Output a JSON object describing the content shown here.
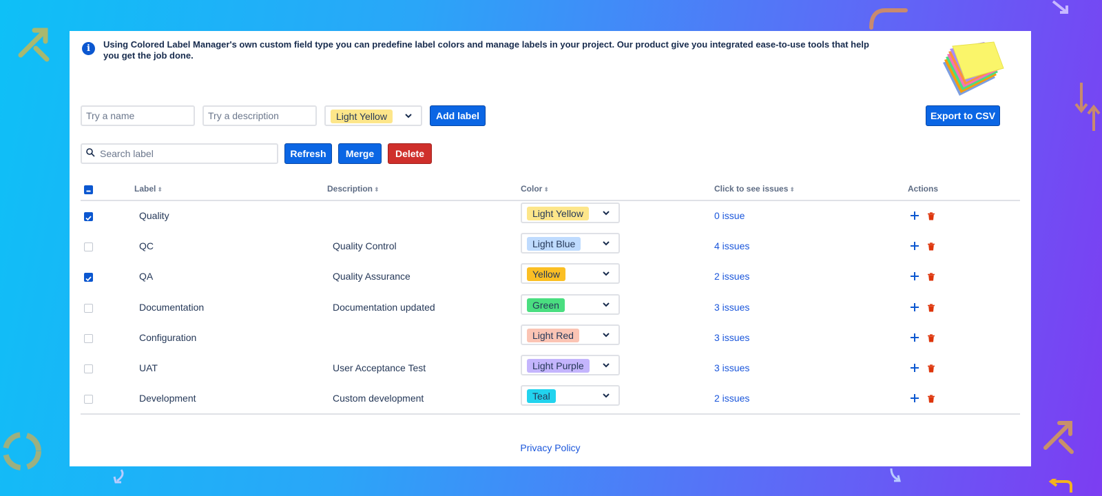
{
  "info": {
    "text": "Using Colored Label Manager's own custom field type you can predefine label colors and manage labels in your project. Our product give you integrated ease-to-use tools that help you get the job done."
  },
  "form": {
    "name_placeholder": "Try a name",
    "description_placeholder": "Try a description",
    "color_value": "Light Yellow",
    "add_label": "Add label",
    "export_csv": "Export to CSV"
  },
  "toolbar": {
    "search_placeholder": "Search label",
    "refresh": "Refresh",
    "merge": "Merge",
    "delete": "Delete"
  },
  "table": {
    "headers": {
      "label": "Label",
      "description": "Description",
      "color": "Color",
      "issues": "Click to see issues",
      "actions": "Actions"
    },
    "rows": [
      {
        "checked": true,
        "label": "Quality",
        "description": "",
        "color": "Light Yellow",
        "color_hex": "#fde68a",
        "issues": "0 issue"
      },
      {
        "checked": false,
        "label": "QC",
        "description": "Quality Control",
        "color": "Light Blue",
        "color_hex": "#bfdbfe",
        "issues": "4 issues"
      },
      {
        "checked": true,
        "label": "QA",
        "description": "Quality Assurance",
        "color": "Yellow",
        "color_hex": "#fbbf24",
        "issues": "2 issues"
      },
      {
        "checked": false,
        "label": "Documentation",
        "description": "Documentation updated",
        "color": "Green",
        "color_hex": "#4ade80",
        "issues": "3 issues"
      },
      {
        "checked": false,
        "label": "Configuration",
        "description": "",
        "color": "Light Red",
        "color_hex": "#fbc4b4",
        "issues": "3 issues"
      },
      {
        "checked": false,
        "label": "UAT",
        "description": "User Acceptance Test",
        "color": "Light Purple",
        "color_hex": "#c4b5fd",
        "issues": "3 issues"
      },
      {
        "checked": false,
        "label": "Development",
        "description": "Custom development",
        "color": "Teal",
        "color_hex": "#22d3ee",
        "issues": "2 issues"
      }
    ]
  },
  "footer": {
    "privacy": "Privacy Policy"
  },
  "colors": {
    "primary": "#0b66e4",
    "danger": "#cf2f2b",
    "link": "#1a56db",
    "light_yellow": "#fde68a"
  }
}
